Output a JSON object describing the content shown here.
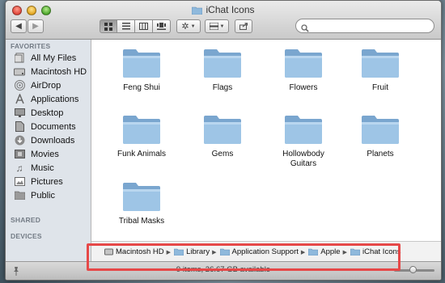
{
  "window": {
    "title": "iChat Icons"
  },
  "search": {
    "placeholder": ""
  },
  "sidebar": {
    "favorites_heading": "FAVORITES",
    "items": [
      {
        "label": "All My Files",
        "icon": "all-files-icon"
      },
      {
        "label": "Macintosh HD",
        "icon": "hard-drive-icon"
      },
      {
        "label": "AirDrop",
        "icon": "airdrop-icon"
      },
      {
        "label": "Applications",
        "icon": "applications-icon"
      },
      {
        "label": "Desktop",
        "icon": "desktop-icon"
      },
      {
        "label": "Documents",
        "icon": "documents-icon"
      },
      {
        "label": "Downloads",
        "icon": "downloads-icon"
      },
      {
        "label": "Movies",
        "icon": "movies-icon"
      },
      {
        "label": "Music",
        "icon": "music-icon"
      },
      {
        "label": "Pictures",
        "icon": "pictures-icon"
      },
      {
        "label": "Public",
        "icon": "public-icon"
      }
    ],
    "shared_heading": "SHARED",
    "devices_heading": "DEVICES"
  },
  "folders": [
    {
      "name": "Feng Shui"
    },
    {
      "name": "Flags"
    },
    {
      "name": "Flowers"
    },
    {
      "name": "Fruit"
    },
    {
      "name": "Funk Animals"
    },
    {
      "name": "Gems"
    },
    {
      "name": "Hollowbody Guitars"
    },
    {
      "name": "Planets"
    },
    {
      "name": "Tribal Masks"
    }
  ],
  "pathbar": {
    "crumbs": [
      "Macintosh HD",
      "Library",
      "Application Support",
      "Apple",
      "iChat Icons"
    ]
  },
  "status": {
    "text": "9 items, 26.67 GB available"
  },
  "colors": {
    "highlight": "#e64848",
    "folder": "#8fb9dc",
    "sidebar": "#dfe4ea"
  }
}
